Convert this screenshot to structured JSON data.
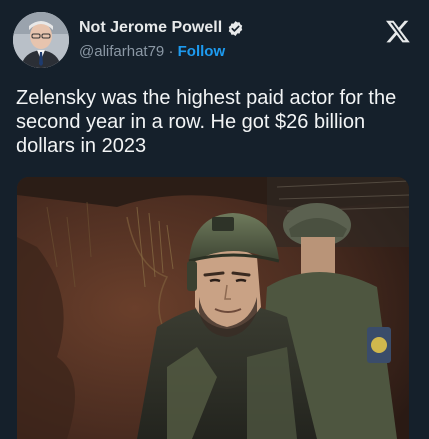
{
  "author": {
    "display_name": "Not Jerome Powell",
    "handle": "@alifarhat79",
    "separator": "·",
    "follow_label": "Follow",
    "verified": true,
    "verified_color": "#1d9bf0"
  },
  "platform_logo": "x-logo",
  "tweet": {
    "text": "Zelensky was the highest paid actor for the second year in a row. He got $26 billion dollars in 2023"
  },
  "media": {
    "type": "photo",
    "subject": "soldier in helmet and camouflage in a trench"
  },
  "colors": {
    "background": "#15202b",
    "text": "#e7e9ea",
    "secondary_text": "#8b98a5",
    "accent": "#1d9bf0"
  }
}
